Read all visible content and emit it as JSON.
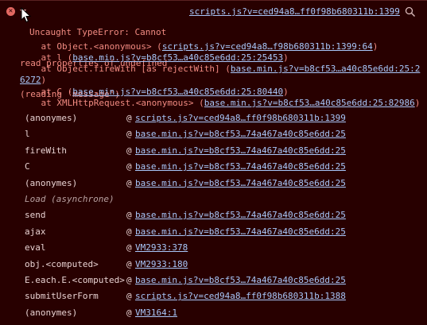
{
  "error": {
    "icon": "error-x-icon",
    "title": "Uncaught TypeError: Cannot",
    "lines": [
      "read properties of undefined",
      "(reading 'message')"
    ],
    "source_link": "scripts.js?v=ced94a8…ff0f98b680311b:1399"
  },
  "stack": [
    {
      "prefix": "    at Object.<anonymous> (",
      "link": "scripts.js?v=ced94a8…f98b680311b:1399:64",
      "suffix": ")"
    },
    {
      "prefix": "    at l (",
      "link": "base.min.js?v=b8cf53…a40c85e6dd:25:25453",
      "suffix": ")"
    },
    {
      "prefix": "    at Object.fireWith [as rejectWith] (",
      "link": "base.min.js?v=b8cf53…a40c85e6dd:25:2",
      "suffix": ""
    },
    {
      "prefix": "",
      "link": "6272",
      "suffix": ")"
    },
    {
      "prefix": "    at C (",
      "link": "base.min.js?v=b8cf53…a40c85e6dd:25:80440",
      "suffix": ")"
    },
    {
      "prefix": "    at XMLHttpRequest.<anonymous> (",
      "link": "base.min.js?v=b8cf53…a40c85e6dd:25:82986",
      "suffix": ")"
    }
  ],
  "frames": [
    {
      "fn": "(anonymes)",
      "at": "@",
      "link": "scripts.js?v=ced94a8…ff0f98b680311b:1399"
    },
    {
      "fn": "l",
      "at": "@",
      "link": "base.min.js?v=b8cf53…74a467a40c85e6dd:25"
    },
    {
      "fn": "fireWith",
      "at": "@",
      "link": "base.min.js?v=b8cf53…74a467a40c85e6dd:25"
    },
    {
      "fn": "C",
      "at": "@",
      "link": "base.min.js?v=b8cf53…74a467a40c85e6dd:25"
    },
    {
      "fn": "(anonymes)",
      "at": "@",
      "link": "base.min.js?v=b8cf53…74a467a40c85e6dd:25"
    },
    {
      "fn": "Load (asynchrone)",
      "at": "",
      "link": "",
      "async": true
    },
    {
      "fn": "send",
      "at": "@",
      "link": "base.min.js?v=b8cf53…74a467a40c85e6dd:25"
    },
    {
      "fn": "ajax",
      "at": "@",
      "link": "base.min.js?v=b8cf53…74a467a40c85e6dd:25"
    },
    {
      "fn": "eval",
      "at": "@",
      "link": "VM2933:378"
    },
    {
      "fn": "obj.<computed>",
      "at": "@",
      "link": "VM2933:180"
    },
    {
      "fn": "E.each.E.<computed>",
      "at": "@",
      "link": "base.min.js?v=b8cf53…74a467a40c85e6dd:25"
    },
    {
      "fn": "submitUserForm",
      "at": "@",
      "link": "scripts.js?v=ced94a8…ff0f98b680311b:1388"
    },
    {
      "fn": "(anonymes)",
      "at": "@",
      "link": "VM3164:1"
    }
  ]
}
